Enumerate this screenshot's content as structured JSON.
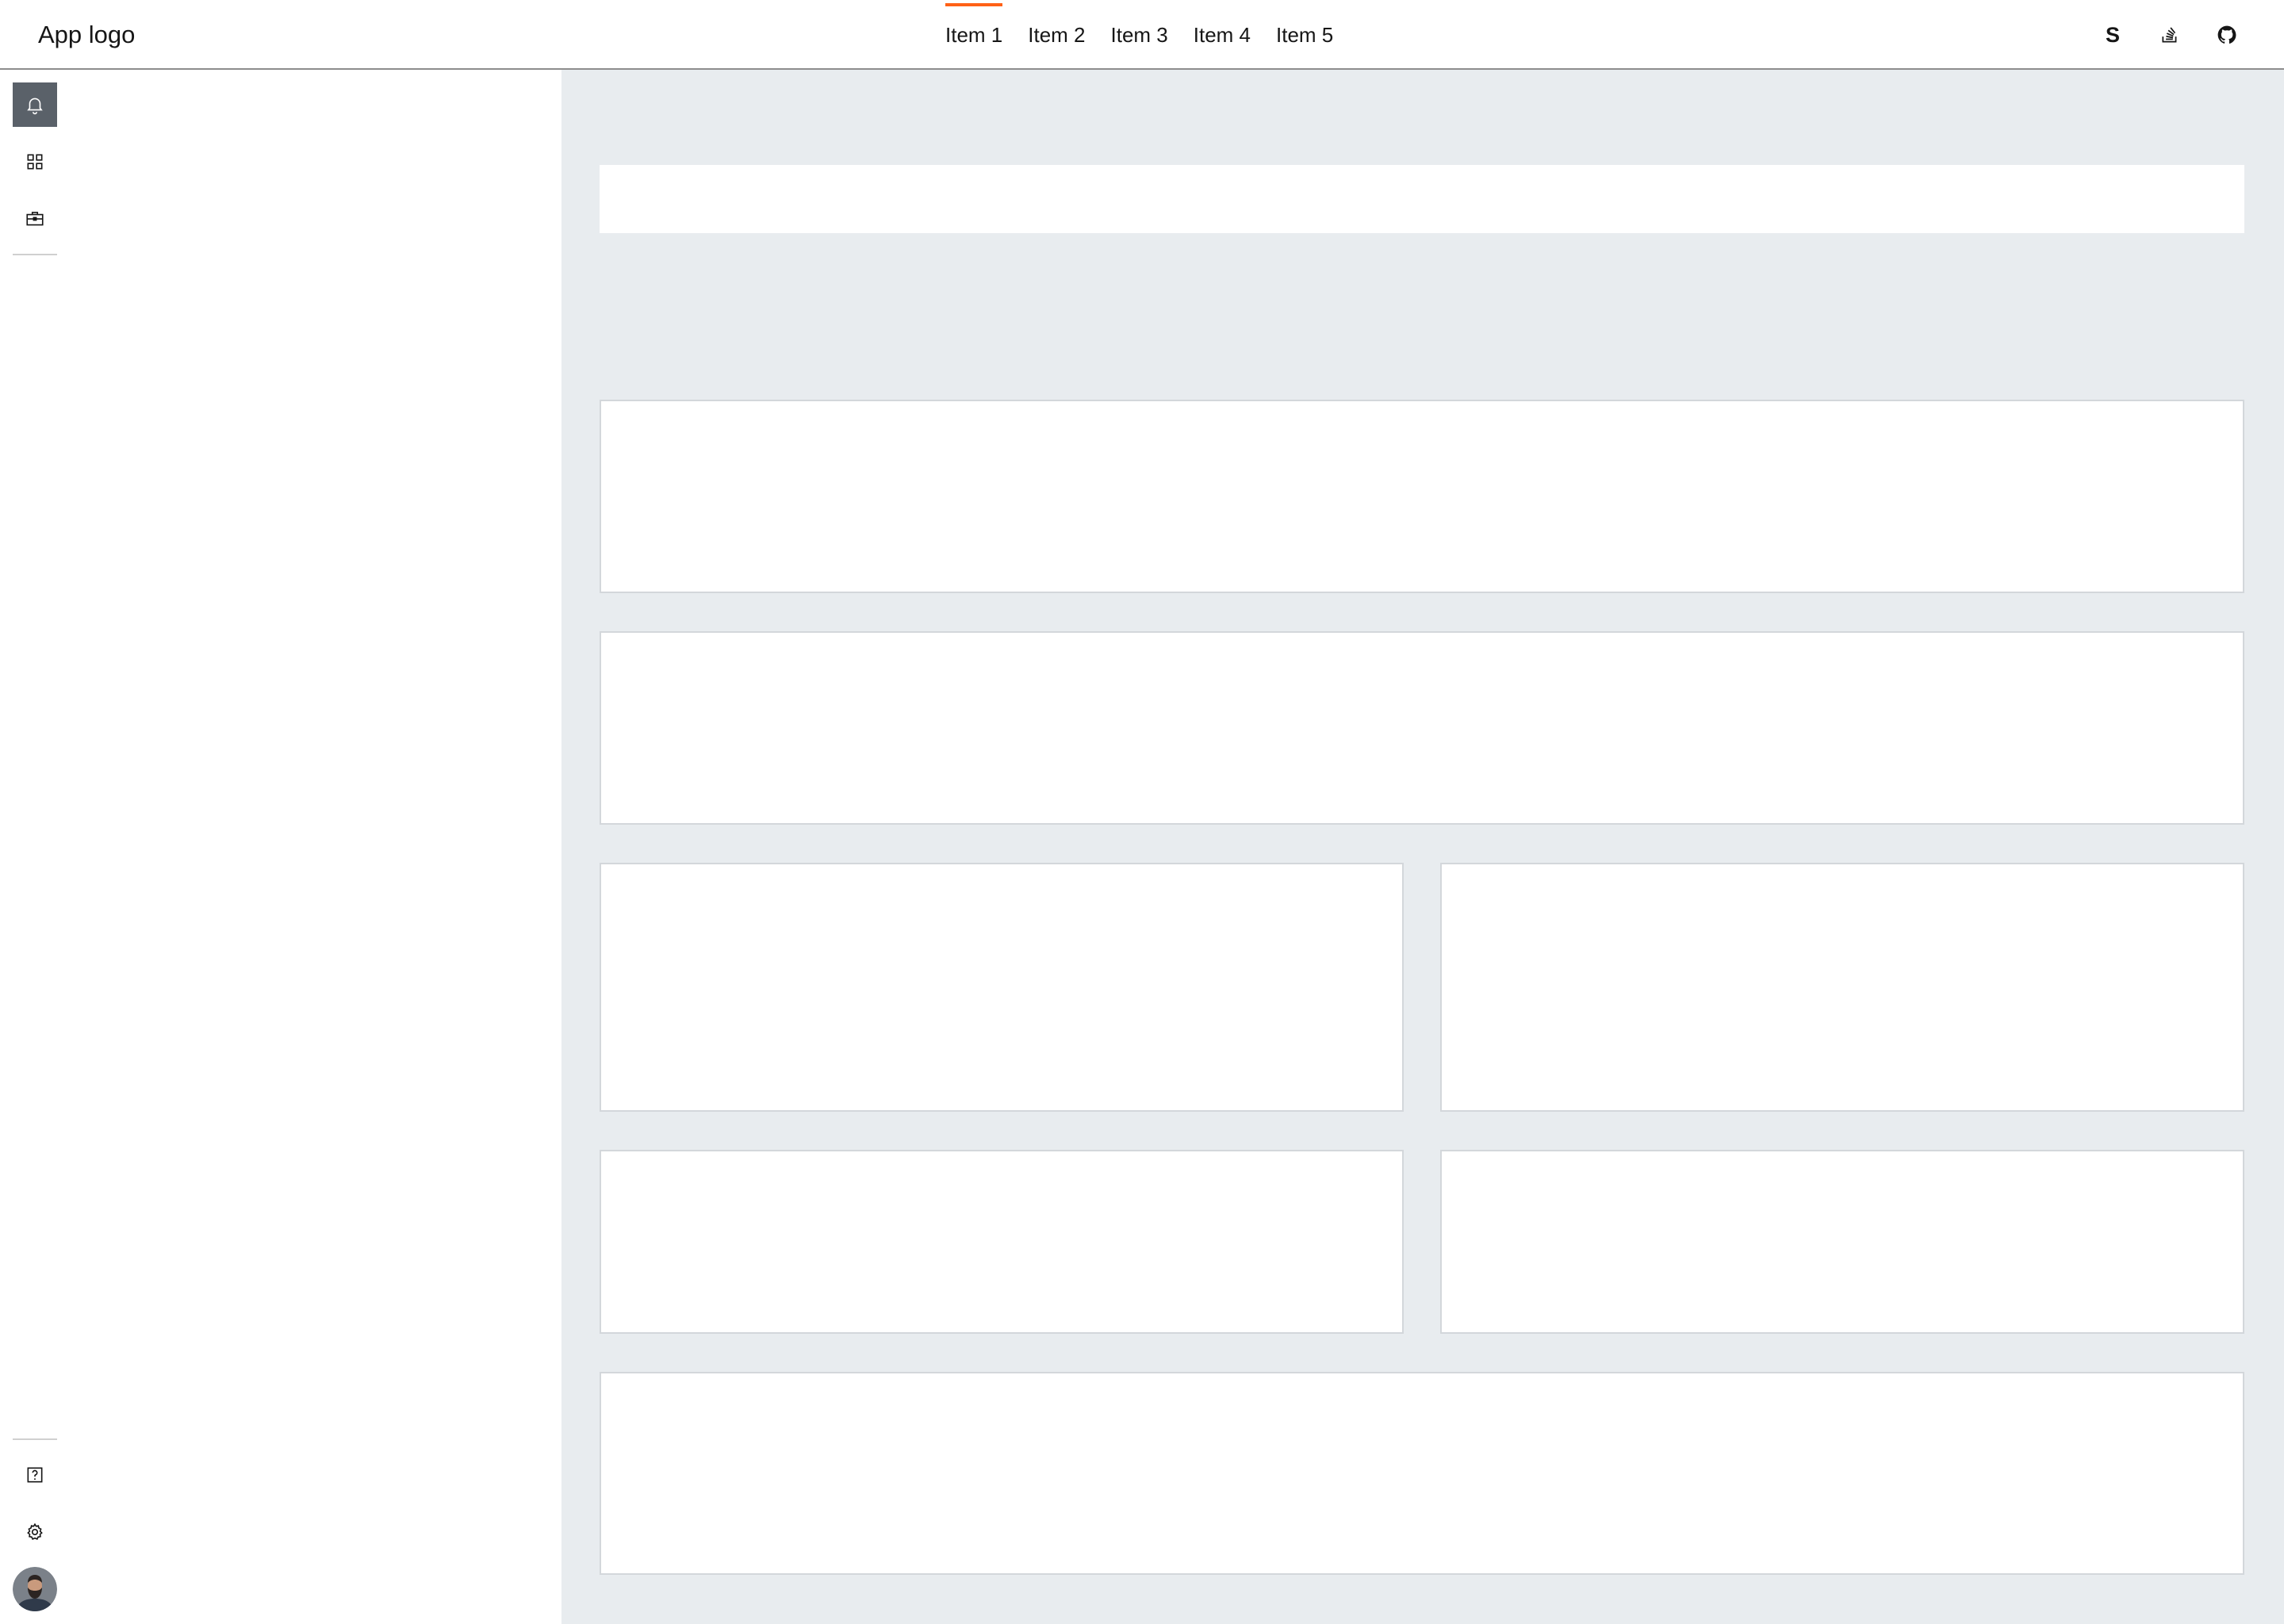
{
  "header": {
    "logo": "App logo",
    "nav": [
      {
        "label": "Item 1",
        "active": true
      },
      {
        "label": "Item 2",
        "active": false
      },
      {
        "label": "Item 3",
        "active": false
      },
      {
        "label": "Item 4",
        "active": false
      },
      {
        "label": "Item 5",
        "active": false
      }
    ],
    "icons": [
      {
        "name": "s-icon",
        "glyph": "S"
      },
      {
        "name": "stack-overflow-icon"
      },
      {
        "name": "github-icon"
      }
    ]
  },
  "rail": {
    "top": [
      "bell-icon",
      "grid-icon",
      "briefcase-icon"
    ],
    "bottom": [
      "help-icon",
      "settings-icon",
      "avatar"
    ],
    "active": "bell-icon"
  },
  "colors": {
    "accent": "#ff6116",
    "rail_active": "#5a6169",
    "content_bg": "#e8ecef",
    "card_border": "#d3d7db"
  }
}
